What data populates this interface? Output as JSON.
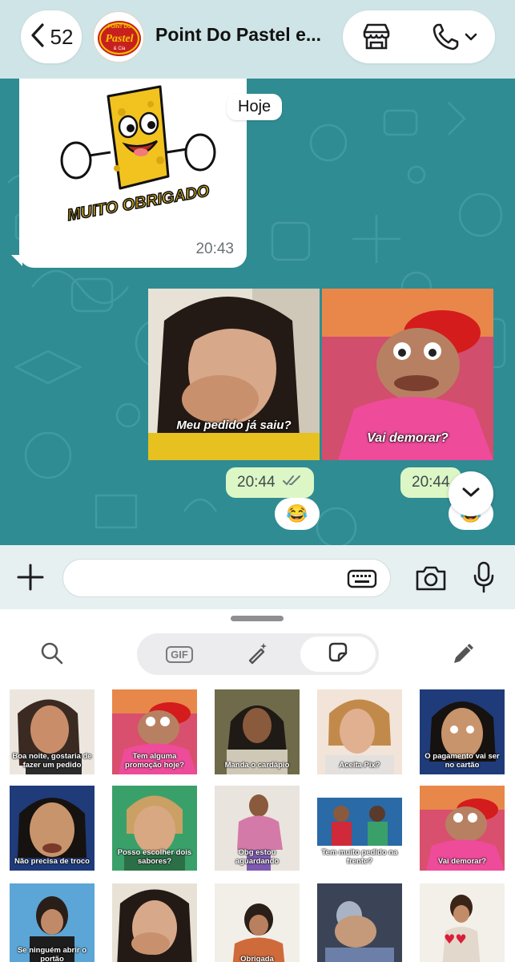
{
  "header": {
    "back_count": "52",
    "chat_title": "Point Do Pastel e...",
    "avatar_logo_text": [
      "POINT DO",
      "Pastel",
      "& Cia"
    ]
  },
  "chat": {
    "date_chip": "Hoje",
    "incoming": {
      "sticker_text": "MUITO OBRIGADO",
      "time": "20:43"
    },
    "outgoing": [
      {
        "caption": "Meu pedido já saiu?",
        "time": "20:44",
        "reaction": "😂"
      },
      {
        "caption": "Vai demorar?",
        "time": "20:44",
        "reaction": "😂"
      }
    ]
  },
  "input": {
    "placeholder": ""
  },
  "sticker_panel": {
    "gif_label": "GIF",
    "stickers": [
      {
        "caption": "Boa noite, gostaria de fazer um pedido"
      },
      {
        "caption": "Tem alguma promoção hoje?"
      },
      {
        "caption": "Manda o cardápio"
      },
      {
        "caption": "Aceita Pix?"
      },
      {
        "caption": "O pagamento vai ser no cartão"
      },
      {
        "caption": "Não precisa de troco"
      },
      {
        "caption": "Posso escolher dois sabores?"
      },
      {
        "caption": "Obg estou aguardando"
      },
      {
        "caption": "Tem muito pedido na frente?"
      },
      {
        "caption": "Vai demorar?"
      },
      {
        "caption": "Se ninguém abrir o portão"
      },
      {
        "caption": ""
      },
      {
        "caption": "Obrigada"
      },
      {
        "caption": ""
      },
      {
        "caption": ""
      }
    ]
  },
  "colors": {
    "chat_bg": "#2f8c93",
    "outgoing_bubble": "#dcf7c5",
    "header_bg": "#cfe4e6",
    "brand_red": "#c8201e",
    "brand_yellow": "#f5c400"
  }
}
